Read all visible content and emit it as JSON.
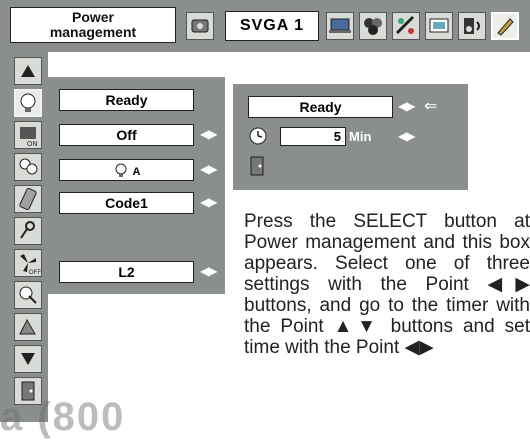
{
  "toolbar": {
    "menu_title_line1": "Power",
    "menu_title_line2": "management",
    "input_source": "SVGA 1"
  },
  "panel_left": {
    "fields": [
      "Ready",
      "Off",
      "A",
      "Code1",
      "L2"
    ]
  },
  "panel_right": {
    "status": "Ready",
    "timer_value": "5",
    "timer_unit": "Min"
  },
  "arrows": {
    "left_right": "◀▶",
    "back": "⇐"
  },
  "description": "Press the SELECT button at Power management and this box appears. Select one of three settings with the Point ◀▶ buttons, and go to the timer with the Point ▲▼ buttons and set time with the Point ◀▶",
  "watermark": "a (800"
}
